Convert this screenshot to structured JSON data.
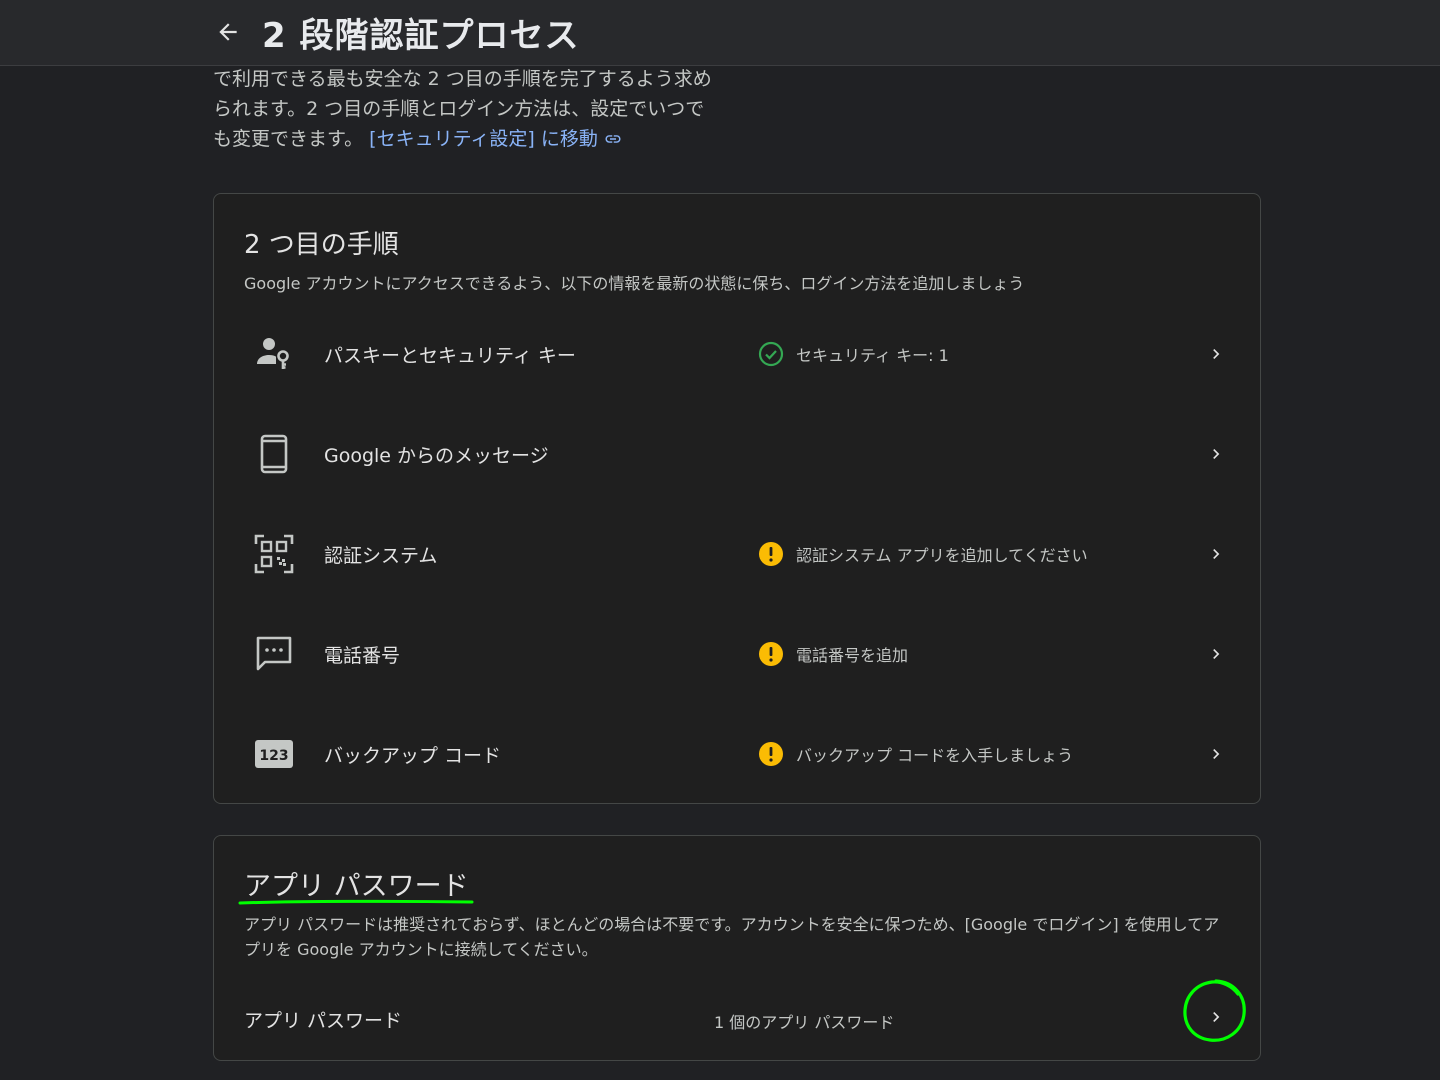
{
  "header": {
    "title": "2 段階認証プロセス"
  },
  "intro": {
    "text": "で利用できる最も安全な 2 つ目の手順を完了するよう求められます。2 つ目の手順とログイン方法は、設定でいつでも変更できます。",
    "link_label": "[セキュリティ設定] に移動"
  },
  "second_step": {
    "title": "2 つ目の手順",
    "description": "Google アカウントにアクセスできるよう、以下の情報を最新の状態に保ち、ログイン方法を追加しましょう",
    "items": [
      {
        "label": "パスキーとセキュリティ キー",
        "status": "セキュリティ キー: 1",
        "icon": "passkey-icon",
        "status_icon": "check-circle-icon"
      },
      {
        "label": "Google からのメッセージ",
        "status": "",
        "icon": "phone-icon",
        "status_icon": ""
      },
      {
        "label": "認証システム",
        "status": "認証システム アプリを追加してください",
        "icon": "qr-code-icon",
        "status_icon": "warning-icon"
      },
      {
        "label": "電話番号",
        "status": "電話番号を追加",
        "icon": "sms-icon",
        "status_icon": "warning-icon"
      },
      {
        "label": "バックアップ コード",
        "status": "バックアップ コードを入手しましょう",
        "icon": "backup-code-icon",
        "status_icon": "warning-icon"
      }
    ]
  },
  "app_passwords": {
    "title": "アプリ パスワード",
    "description": "アプリ パスワードは推奨されておらず、ほとんどの場合は不要です。アカウントを安全に保つため、[Google でログイン] を使用してアプリを Google アカウントに接続してください。",
    "row_label": "アプリ パスワード",
    "row_count": "1 個のアプリ パスワード"
  },
  "icons": {
    "backup_code_glyph": "123"
  },
  "colors": {
    "background": "#202124",
    "card": "#1f1f1f",
    "link": "#8ab4f8",
    "success": "#34a853",
    "warning": "#fbbc04",
    "annotation": "#00ff00"
  }
}
